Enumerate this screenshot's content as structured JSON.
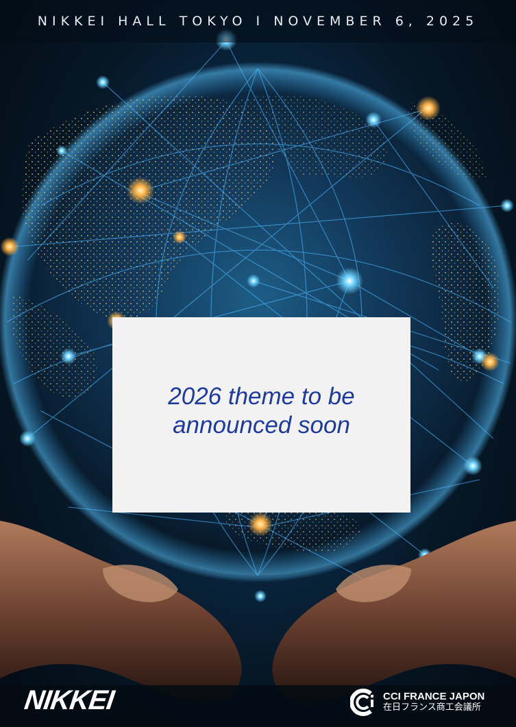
{
  "header": {
    "event_line": "NIKKEI HALL TOKYO  I  NOVEMBER 6, 2025"
  },
  "theme": {
    "announcement": "2026 theme to be announced soon"
  },
  "footer": {
    "nikkei_logo": "NIKKEI",
    "cci_name": "CCI FRANCE JAPON",
    "cci_japanese": "在日フランス商工会議所"
  },
  "colors": {
    "announcement_text": "#1f3a9e",
    "box_background": "#f2f2f3",
    "glow_orange": "#ffb347",
    "glow_blue": "#6fd3ff"
  }
}
